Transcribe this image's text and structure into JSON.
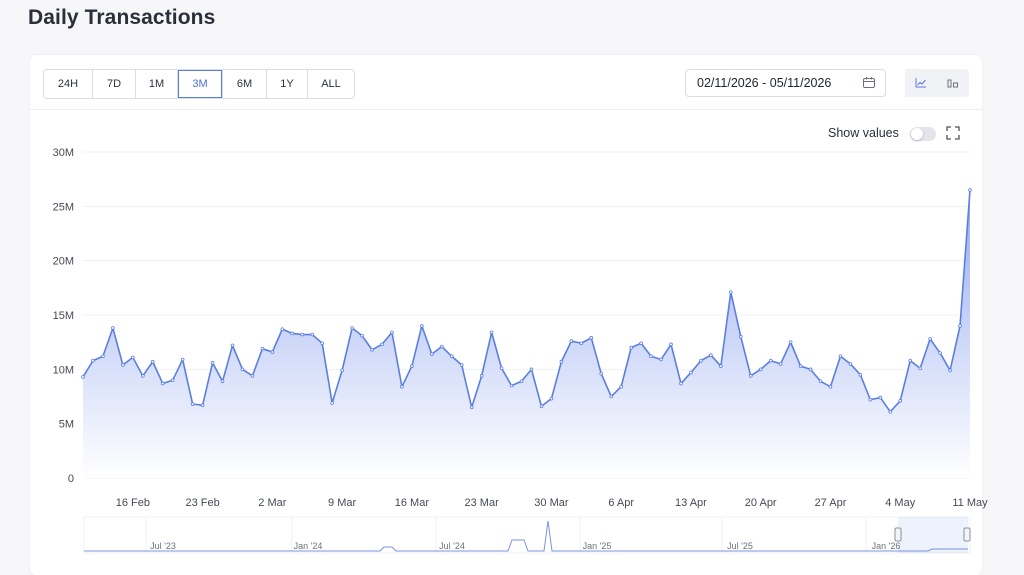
{
  "page": {
    "title": "Daily Transactions"
  },
  "toolbar": {
    "ranges": [
      "24H",
      "7D",
      "1M",
      "3M",
      "6M",
      "1Y",
      "ALL"
    ],
    "active_range": "3M",
    "date_range": "02/11/2026 - 05/11/2026",
    "calendar_icon": "calendar-icon",
    "view_icons": [
      "line-chart-icon",
      "bar-chart-icon"
    ],
    "active_view": "line-chart-icon"
  },
  "controls": {
    "show_values_label": "Show values",
    "show_values_on": false,
    "fullscreen_icon": "fullscreen-icon"
  },
  "colors": {
    "line": "#5b7fe0",
    "fill_top": "#9fb3f2",
    "fill_bottom": "#ffffff",
    "navigator_line": "#7a95e6"
  },
  "chart_data": {
    "type": "area",
    "title": "Daily Transactions",
    "xlabel": "",
    "ylabel": "",
    "ylim": [
      0,
      30000000
    ],
    "y_ticks": [
      {
        "value": 0,
        "label": "0"
      },
      {
        "value": 5000000,
        "label": "5M"
      },
      {
        "value": 10000000,
        "label": "10M"
      },
      {
        "value": 15000000,
        "label": "15M"
      },
      {
        "value": 20000000,
        "label": "20M"
      },
      {
        "value": 25000000,
        "label": "25M"
      },
      {
        "value": 30000000,
        "label": "30M"
      }
    ],
    "x_start": "2026-02-11",
    "x_ticks": [
      {
        "date": "2026-02-16",
        "label": "16 Feb"
      },
      {
        "date": "2026-02-23",
        "label": "23 Feb"
      },
      {
        "date": "2026-03-02",
        "label": "2 Mar"
      },
      {
        "date": "2026-03-09",
        "label": "9 Mar"
      },
      {
        "date": "2026-03-16",
        "label": "16 Mar"
      },
      {
        "date": "2026-03-23",
        "label": "23 Mar"
      },
      {
        "date": "2026-03-30",
        "label": "30 Mar"
      },
      {
        "date": "2026-04-06",
        "label": "6 Apr"
      },
      {
        "date": "2026-04-13",
        "label": "13 Apr"
      },
      {
        "date": "2026-04-20",
        "label": "20 Apr"
      },
      {
        "date": "2026-04-27",
        "label": "27 Apr"
      },
      {
        "date": "2026-05-04",
        "label": "4 May"
      },
      {
        "date": "2026-05-11",
        "label": "11 May"
      }
    ],
    "grid": true,
    "legend": "none",
    "values_millions": [
      9.3,
      10.8,
      11.2,
      13.8,
      10.4,
      11.1,
      9.4,
      10.7,
      8.7,
      9.0,
      10.9,
      6.8,
      6.7,
      10.6,
      8.9,
      12.2,
      10.0,
      9.4,
      11.9,
      11.6,
      13.7,
      13.3,
      13.2,
      13.2,
      12.4,
      6.9,
      9.9,
      13.8,
      13.1,
      11.8,
      12.3,
      13.4,
      8.4,
      10.3,
      14.0,
      11.4,
      12.1,
      11.2,
      10.4,
      6.5,
      9.4,
      13.4,
      10.1,
      8.5,
      8.9,
      10.0,
      6.6,
      7.3,
      10.7,
      12.6,
      12.4,
      12.9,
      9.6,
      7.5,
      8.4,
      12.0,
      12.4,
      11.2,
      10.9,
      12.3,
      8.7,
      9.7,
      10.8,
      11.3,
      10.3,
      17.1,
      13.0,
      9.4,
      10.0,
      10.8,
      10.5,
      12.5,
      10.3,
      10.0,
      8.9,
      8.4,
      11.2,
      10.5,
      9.5,
      7.2,
      7.4,
      6.1,
      7.1,
      10.8,
      10.1,
      12.8,
      11.5,
      9.9,
      14.0,
      26.5
    ]
  },
  "navigator": {
    "labels": [
      "Jul '23",
      "Jan '24",
      "Jul '24",
      "Jan '25",
      "Jul '25",
      "Jan '26"
    ]
  }
}
